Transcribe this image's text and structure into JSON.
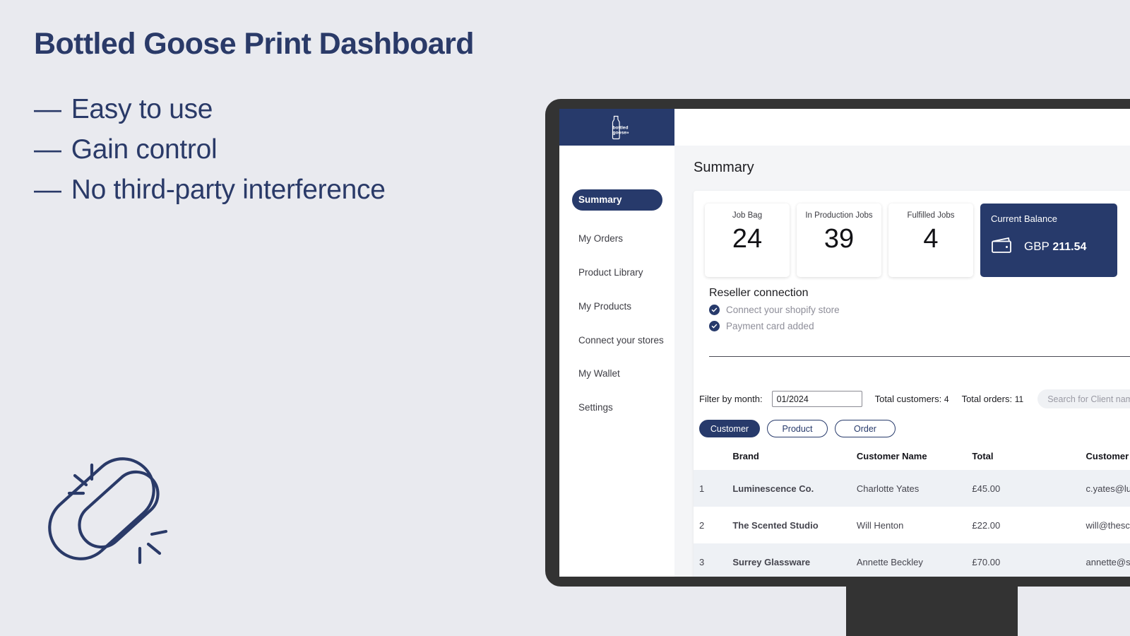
{
  "promo": {
    "title": "Bottled Goose Print Dashboard",
    "dash": "—",
    "bullets": [
      "Easy to use",
      "Gain control",
      "No third-party interference"
    ],
    "accent_color": "#2a3a68",
    "background_color": "#e9eaef",
    "illustration": "chain-link-icon"
  },
  "app": {
    "logo_text_line1": "bottled",
    "logo_text_line2": "goose»",
    "navy": "#273a6b"
  },
  "sidebar": {
    "items": [
      {
        "label": "Summary",
        "active": true
      },
      {
        "label": "My Orders",
        "active": false
      },
      {
        "label": "Product Library",
        "active": false
      },
      {
        "label": "My Products",
        "active": false
      },
      {
        "label": "Connect your stores",
        "active": false
      },
      {
        "label": "My Wallet",
        "active": false
      },
      {
        "label": "Settings",
        "active": false
      }
    ]
  },
  "main": {
    "page_title": "Summary",
    "stats": [
      {
        "label": "Job Bag",
        "value": "24"
      },
      {
        "label": "In Production Jobs",
        "value": "39"
      },
      {
        "label": "Fulfilled Jobs",
        "value": "4"
      }
    ],
    "balance": {
      "label": "Current Balance",
      "currency": "GBP",
      "amount": "211.54",
      "icon": "wallet-icon"
    },
    "reseller": {
      "title": "Reseller connection",
      "checks": [
        {
          "label": "Connect your shopify store",
          "done": true
        },
        {
          "label": "Payment card added",
          "done": true
        }
      ]
    },
    "filters": {
      "month_label": "Filter by month:",
      "month_value": "01/2024",
      "total_customers_label": "Total customers:",
      "total_customers_value": "4",
      "total_orders_label": "Total orders:",
      "total_orders_value": "11",
      "search_placeholder": "Search for Client name"
    },
    "tabs": [
      {
        "label": "Customer",
        "active": true
      },
      {
        "label": "Product",
        "active": false
      },
      {
        "label": "Order",
        "active": false
      }
    ],
    "table": {
      "columns": [
        "",
        "Brand",
        "Customer Name",
        "Total",
        "Customer Email"
      ],
      "rows": [
        {
          "index": "1",
          "brand": "Luminescence Co.",
          "customer_name": "Charlotte Yates",
          "total": "£45.00",
          "email": "c.yates@luminescence.com"
        },
        {
          "index": "2",
          "brand": "The Scented Studio",
          "customer_name": "Will Henton",
          "total": "£22.00",
          "email": "will@thescentedcandle.com"
        },
        {
          "index": "3",
          "brand": "Surrey Glassware",
          "customer_name": "Annette Beckley",
          "total": "£70.00",
          "email": "annette@surreyglassware.com"
        }
      ]
    }
  }
}
